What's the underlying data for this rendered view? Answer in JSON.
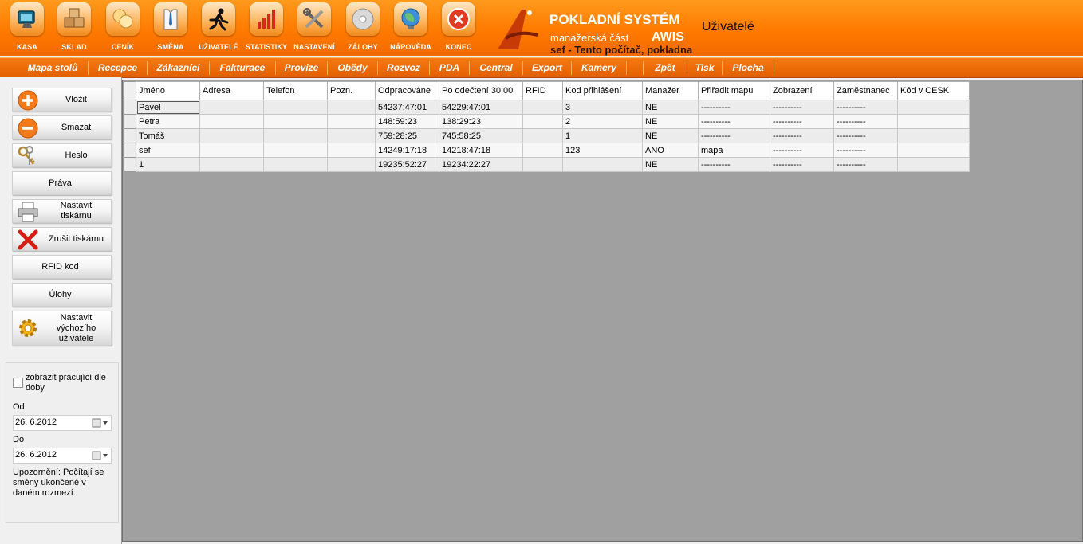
{
  "toolbar": {
    "items": [
      {
        "label": "KASA",
        "icon": "monitor-icon"
      },
      {
        "label": "SKLAD",
        "icon": "boxes-icon"
      },
      {
        "label": "CENÍK",
        "icon": "coins-icon"
      },
      {
        "label": "SMĚNA",
        "icon": "shirt-icon"
      },
      {
        "label": "UŽIVATELÉ",
        "icon": "running-man-icon"
      },
      {
        "label": "STATISTIKY",
        "icon": "bar-chart-icon"
      },
      {
        "label": "NASTAVENÍ",
        "icon": "tools-icon"
      },
      {
        "label": "ZÁLOHY",
        "icon": "disc-icon"
      },
      {
        "label": "NÁPOVĚDA",
        "icon": "globe-icon"
      },
      {
        "label": "KONEC",
        "icon": "close-icon"
      }
    ]
  },
  "brand": {
    "title": "POKLADNÍ SYSTÉM",
    "subtitle": "manažerská část",
    "product": "AWIS",
    "user_line": "sef  -  Tento počítač, pokladna"
  },
  "page_title": "Uživatelé",
  "menu": {
    "items": [
      "Mapa stolů",
      "Recepce",
      "Zákazníci",
      "Fakturace",
      "Provize",
      "Obědy",
      "Rozvoz",
      "PDA",
      "Central",
      "Export",
      "Kamery",
      "",
      "Zpět",
      "Tisk",
      "Plocha"
    ]
  },
  "sidebar": {
    "buttons": [
      {
        "label": "Vložit",
        "icon": "plus-icon"
      },
      {
        "label": "Smazat",
        "icon": "minus-icon"
      },
      {
        "label": "Heslo",
        "icon": "keys-icon"
      },
      {
        "label": "Práva",
        "icon": ""
      },
      {
        "label": "Nastavit tiskárnu",
        "icon": "printer-icon"
      },
      {
        "label": "Zrušit tiskárnu",
        "icon": "red-x-icon"
      },
      {
        "label": "RFID kod",
        "icon": ""
      },
      {
        "label": "Úlohy",
        "icon": ""
      },
      {
        "label": "Nastavit výchozího uživatele",
        "icon": "gear-icon"
      }
    ],
    "filter": {
      "checkbox_label": "zobrazit pracující dle doby",
      "checked": false,
      "from_label": "Od",
      "from_value": "26.  6.2012",
      "to_label": "Do",
      "to_value": "26.  6.2012",
      "note": "Upozornění: Počítají se směny ukončené v daném rozmezí."
    }
  },
  "grid": {
    "columns": [
      "Jméno",
      "Adresa",
      "Telefon",
      "Pozn.",
      "Odpracováne",
      "Po odečtení 30:00",
      "RFID",
      "Kod přihlášení",
      "Manažer",
      "Přiřadit mapu",
      "Zobrazení",
      "Zaměstnanec",
      "Kód v CESK"
    ],
    "rows": [
      [
        "Pavel",
        "",
        "",
        "",
        "54237:47:01",
        "54229:47:01",
        "",
        "3",
        "NE",
        "----------",
        "----------",
        "----------",
        ""
      ],
      [
        "Petra",
        "",
        "",
        "",
        "148:59:23",
        "138:29:23",
        "",
        "2",
        "NE",
        "----------",
        "----------",
        "----------",
        ""
      ],
      [
        "Tomáš",
        "",
        "",
        "",
        "759:28:25",
        "745:58:25",
        "",
        "1",
        "NE",
        "----------",
        "----------",
        "----------",
        ""
      ],
      [
        "sef",
        "",
        "",
        "",
        "14249:17:18",
        "14218:47:18",
        "",
        "123",
        "ANO",
        "mapa",
        "----------",
        "----------",
        ""
      ],
      [
        "1",
        "",
        "",
        "",
        "19235:52:27",
        "19234:22:27",
        "",
        "",
        "NE",
        "----------",
        "----------",
        "----------",
        ""
      ]
    ]
  }
}
